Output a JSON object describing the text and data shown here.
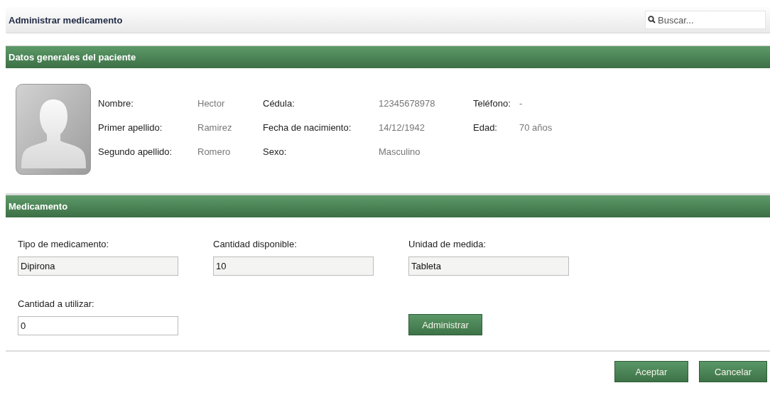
{
  "header": {
    "title": "Administrar medicamento",
    "search": {
      "placeholder": "Buscar..."
    }
  },
  "patient_section": {
    "title": "Datos generales del paciente",
    "fields": [
      {
        "label": "Nombre:",
        "value": "Hector"
      },
      {
        "label": "Cédula:",
        "value": "12345678978"
      },
      {
        "label": "Teléfono:",
        "value": "-"
      },
      {
        "label": "Primer apellido:",
        "value": "Ramirez"
      },
      {
        "label": "Fecha de nacimiento:",
        "value": "14/12/1942"
      },
      {
        "label": "Edad:",
        "value": "70 años"
      },
      {
        "label": "Segundo apellido:",
        "value": "Romero"
      },
      {
        "label": "Sexo:",
        "value": "Masculino"
      }
    ]
  },
  "medication_section": {
    "title": "Medicamento",
    "fields": [
      {
        "label": "Tipo de medicamento:",
        "value": "Dipirona",
        "disabled": true
      },
      {
        "label": "Cantidad disponible:",
        "value": "10",
        "disabled": true
      },
      {
        "label": "Unidad de medida:",
        "value": "Tableta",
        "disabled": true
      },
      {
        "label": "Cantidad a utilizar:",
        "value": "0",
        "disabled": false
      }
    ],
    "administer_button": "Administrar"
  },
  "buttons": [
    "Aceptar",
    "Cancelar"
  ]
}
